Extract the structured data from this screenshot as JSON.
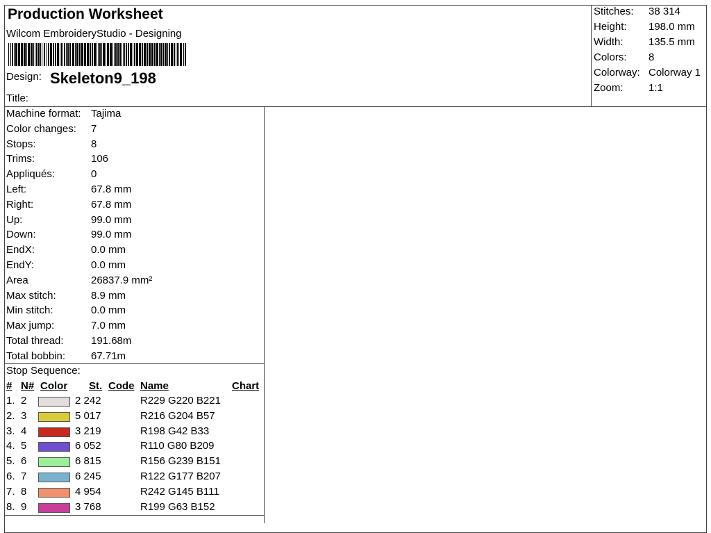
{
  "header": {
    "title": "Production Worksheet",
    "software": "Wilcom EmbroideryStudio - Designing",
    "design_label": "Design:",
    "design_name": "Skeleton9_198",
    "title_label": "Title:"
  },
  "stats": [
    {
      "label": "Stitches:",
      "value": "38 314"
    },
    {
      "label": "Height:",
      "value": "198.0 mm"
    },
    {
      "label": "Width:",
      "value": "135.5 mm"
    },
    {
      "label": "Colors:",
      "value": "8"
    },
    {
      "label": "Colorway:",
      "value": "Colorway 1"
    },
    {
      "label": "Zoom:",
      "value": "1:1"
    }
  ],
  "info": [
    {
      "label": "Machine format:",
      "value": "Tajima"
    },
    {
      "label": "Color changes:",
      "value": "7"
    },
    {
      "label": "Stops:",
      "value": "8"
    },
    {
      "label": "Trims:",
      "value": "106"
    },
    {
      "label": "Appliqués:",
      "value": "0"
    },
    {
      "label": "Left:",
      "value": "67.8 mm"
    },
    {
      "label": "Right:",
      "value": "67.8 mm"
    },
    {
      "label": "Up:",
      "value": "99.0 mm"
    },
    {
      "label": "Down:",
      "value": "99.0 mm"
    },
    {
      "label": "EndX:",
      "value": "0.0 mm"
    },
    {
      "label": "EndY:",
      "value": "0.0 mm"
    },
    {
      "label": "Area",
      "value": "26837.9 mm²"
    },
    {
      "label": "Max stitch:",
      "value": "8.9 mm"
    },
    {
      "label": "Min stitch:",
      "value": "0.0 mm"
    },
    {
      "label": "Max jump:",
      "value": "7.0 mm"
    },
    {
      "label": "Total thread:",
      "value": "191.68m"
    },
    {
      "label": "Total bobbin:",
      "value": "67.71m"
    }
  ],
  "stop_sequence": {
    "title": "Stop Sequence:",
    "headers": {
      "idx": "#",
      "n": "N#",
      "color": "Color",
      "st": "St.",
      "code": "Code",
      "name": "Name",
      "chart": "Chart"
    },
    "rows": [
      {
        "idx": "1.",
        "n": "2",
        "color": "#E5DCDD",
        "st": "2 242",
        "name": "R229 G220 B221"
      },
      {
        "idx": "2.",
        "n": "3",
        "color": "#D8CC39",
        "st": "5 017",
        "name": "R216 G204 B57"
      },
      {
        "idx": "3.",
        "n": "4",
        "color": "#C62A21",
        "st": "3 219",
        "name": "R198 G42 B33"
      },
      {
        "idx": "4.",
        "n": "5",
        "color": "#6E50D1",
        "st": "6 052",
        "name": "R110 G80 B209"
      },
      {
        "idx": "5.",
        "n": "6",
        "color": "#9CEF97",
        "st": "6 815",
        "name": "R156 G239 B151"
      },
      {
        "idx": "6.",
        "n": "7",
        "color": "#7AB1CF",
        "st": "6 245",
        "name": "R122 G177 B207"
      },
      {
        "idx": "7.",
        "n": "8",
        "color": "#F2916F",
        "st": "4 954",
        "name": "R242 G145 B111"
      },
      {
        "idx": "8.",
        "n": "9",
        "color": "#C73F98",
        "st": "3 768",
        "name": "R199 G63 B152"
      }
    ]
  }
}
